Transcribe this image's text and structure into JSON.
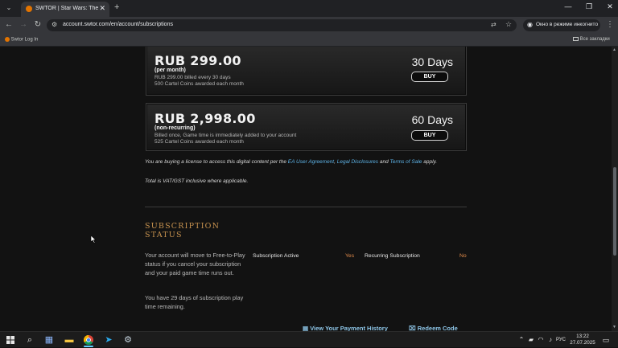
{
  "browser": {
    "tab_title": "SWTOR | Star Wars: The Old Re",
    "url": "account.swtor.com/en/account/subscriptions",
    "incognito_label": "Окно в режиме инкогнито",
    "bookmark": "Swtor Log In",
    "all_bookmarks": "Все закладки"
  },
  "plans": [
    {
      "price": "RUB 299.00",
      "type": "(per month)",
      "desc1": "RUB 299.00 billed every 30 days",
      "desc2": "500 Cartel Coins awarded each month",
      "days": "30 Days",
      "buy": "BUY"
    },
    {
      "price": "RUB 2,998.00",
      "type": "(non-recurring)",
      "desc1": "Billed once, Game time is immediately added to your account",
      "desc2": "525 Cartel Coins awarded each month",
      "days": "60 Days",
      "buy": "BUY"
    }
  ],
  "legal": {
    "part1": "You are buying a license to access this digital content per the",
    "link1": "EA User Agreement",
    "sep1": ",",
    "link2": "Legal Disclosures",
    "and": "and",
    "link3": "Terms of Sale",
    "part2": "apply.",
    "vat": "Total is VAT/GST inclusive where applicable."
  },
  "status": {
    "title1": "SUBSCRIPTION",
    "title2": "STATUS",
    "para1": "Your account will move to Free-to-Play status if you cancel your subscription and your paid game time runs out.",
    "para2": "You have 29 days of subscription play time remaining.",
    "active_label": "Subscription Active",
    "active_value": "Yes",
    "recurring_label": "Recurring Subscription",
    "recurring_value": "No",
    "payment_btn": "View Your Payment History",
    "redeem_btn": "Redeem Code"
  },
  "taskbar": {
    "time": "13:22",
    "date": "27.07.2025",
    "lang": "РУС"
  },
  "colors": {
    "accent_gold": "#c8934f",
    "link_blue": "#5eb4e8",
    "value_orange": "#e08a4a"
  }
}
